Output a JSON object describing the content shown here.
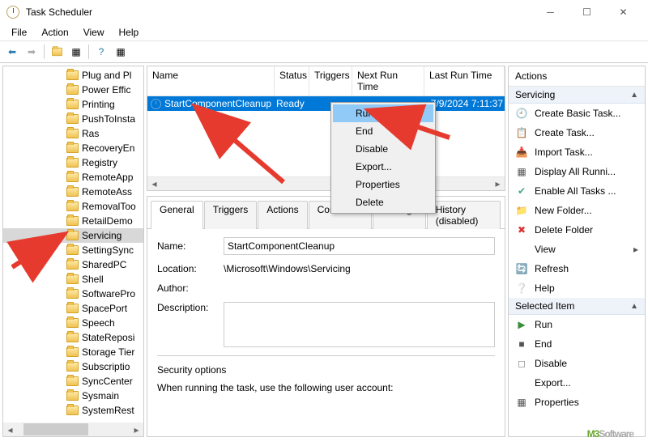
{
  "window": {
    "title": "Task Scheduler"
  },
  "menu": {
    "file": "File",
    "action": "Action",
    "view": "View",
    "help": "Help"
  },
  "tree": {
    "items": [
      "Plug and Pl",
      "Power Effic",
      "Printing",
      "PushToInsta",
      "Ras",
      "RecoveryEn",
      "Registry",
      "RemoteApp",
      "RemoteAss",
      "RemovalToo",
      "RetailDemo",
      "Servicing",
      "SettingSync",
      "SharedPC",
      "Shell",
      "SoftwarePro",
      "SpacePort",
      "Speech",
      "StateReposi",
      "Storage Tier",
      "Subscriptio",
      "SyncCenter",
      "Sysmain",
      "SystemRest"
    ],
    "selected": "Servicing"
  },
  "list": {
    "cols": {
      "name": "Name",
      "status": "Status",
      "triggers": "Triggers",
      "next": "Next Run Time",
      "last": "Last Run Time"
    },
    "row": {
      "name": "StartComponentCleanup",
      "status": "Ready",
      "triggers": "",
      "next": "",
      "last": "7/9/2024 7:11:37"
    }
  },
  "tabs": {
    "general": "General",
    "triggers": "Triggers",
    "actions": "Actions",
    "conditions": "Conditions",
    "settings": "Settings",
    "history": "History (disabled)"
  },
  "details": {
    "name_label": "Name:",
    "name": "StartComponentCleanup",
    "location_label": "Location:",
    "location": "\\Microsoft\\Windows\\Servicing",
    "author_label": "Author:",
    "author": "",
    "description_label": "Description:",
    "description": "",
    "security_hdr": "Security options",
    "security_text": "When running the task, use the following user account:"
  },
  "actions": {
    "title": "Actions",
    "group1": "Servicing",
    "items1": [
      "Create Basic Task...",
      "Create Task...",
      "Import Task...",
      "Display All Runni...",
      "Enable All Tasks ...",
      "New Folder...",
      "Delete Folder",
      "View",
      "Refresh",
      "Help"
    ],
    "group2": "Selected Item",
    "items2": [
      "Run",
      "End",
      "Disable",
      "Export...",
      "Properties"
    ]
  },
  "ctx": {
    "run": "Run",
    "end": "End",
    "disable": "Disable",
    "export": "Export...",
    "properties": "Properties",
    "delete": "Delete"
  },
  "watermark": {
    "m3": "M3",
    "rest": "Software"
  }
}
